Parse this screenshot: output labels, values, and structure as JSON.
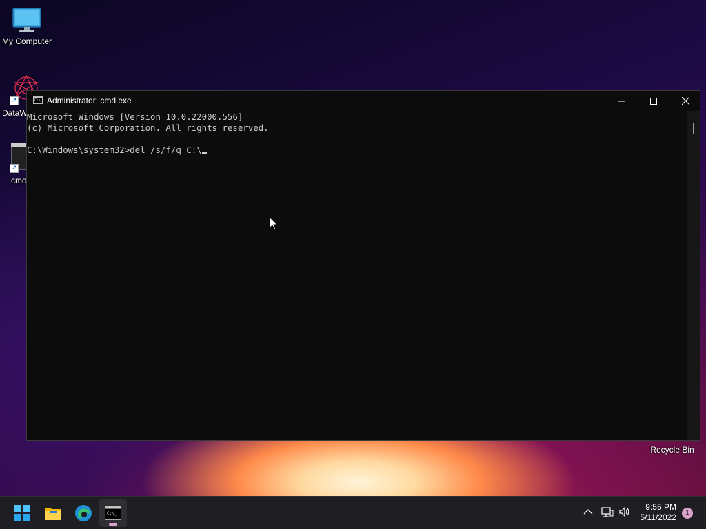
{
  "desktop": {
    "icons": [
      {
        "label": "My Computer"
      },
      {
        "label": "DataW"
      },
      {
        "label": "cmd"
      }
    ],
    "recycle_bin_label": "Recycle Bin"
  },
  "window": {
    "title": "Administrator: cmd.exe",
    "console_lines": [
      "Microsoft Windows [Version 10.0.22000.556]",
      "(c) Microsoft Corporation. All rights reserved.",
      "",
      "C:\\Windows\\system32>del /s/f/q C:\\"
    ]
  },
  "taskbar": {
    "apps": [
      {
        "name": "start-button-icon"
      },
      {
        "name": "file-explorer-icon"
      },
      {
        "name": "edge-browser-icon"
      },
      {
        "name": "cmd-icon",
        "active": true
      }
    ],
    "clock_time": "9:55 PM",
    "clock_date": "5/11/2022",
    "notification_count": "1"
  },
  "colors": {
    "console_bg": "#0c0c0c",
    "console_fg": "#cccccc",
    "taskbar_bg": "#1f1f23",
    "accent": "#d9a3c9"
  }
}
